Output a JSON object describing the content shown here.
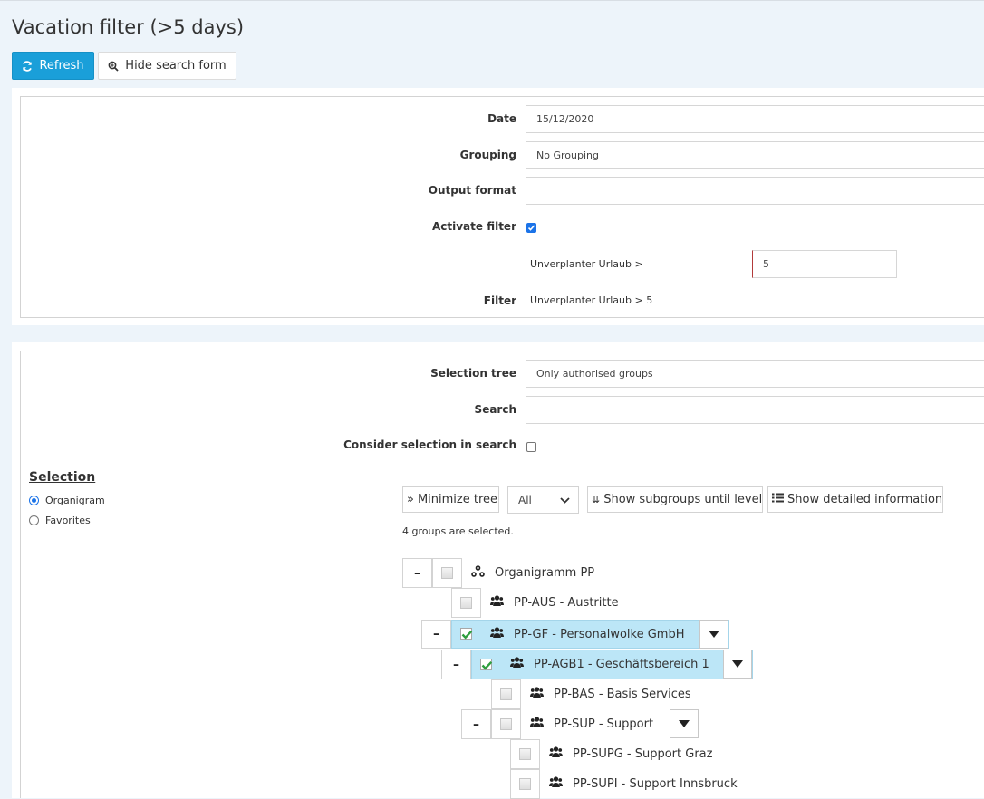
{
  "page": {
    "title": "Vacation filter (>5 days)"
  },
  "toolbar": {
    "refresh_label": "Refresh",
    "hide_label": "Hide search form"
  },
  "form": {
    "date_label": "Date",
    "date_value": "15/12/2020",
    "grouping_label": "Grouping",
    "grouping_value": "No Grouping",
    "output_label": "Output format",
    "output_value": "",
    "activate_label": "Activate filter",
    "activate_checked": true,
    "threshold_label": "Unverplanter Urlaub >",
    "threshold_value": "5",
    "filter_label": "Filter",
    "filter_value": "Unverplanter Urlaub > 5"
  },
  "selection_form": {
    "tree_label": "Selection tree",
    "tree_value": "Only authorised groups",
    "search_label": "Search",
    "search_value": "",
    "consider_label": "Consider selection in search",
    "consider_checked": false
  },
  "selection": {
    "title": "Selection",
    "options": [
      {
        "label": "Organigram",
        "selected": true
      },
      {
        "label": "Favorites",
        "selected": false
      }
    ]
  },
  "tree_toolbar": {
    "minimize_label": "Minimize tree",
    "level_value": "All",
    "subgroups_label": "Show subgroups until level",
    "detailed_label": "Show detailed information"
  },
  "status": {
    "selected_text": "4 groups are selected."
  },
  "tree": {
    "toggle_glyph": "–",
    "nodes": [
      {
        "label": "Organigramm PP",
        "icon": "sitemap-icon",
        "checked": false
      },
      {
        "label": "PP-AUS - Austritte",
        "icon": "users-icon",
        "checked": false
      },
      {
        "label": "PP-GF - Personalwolke GmbH",
        "icon": "users-icon",
        "checked": true
      },
      {
        "label": "PP-AGB1 - Geschäftsbereich 1",
        "icon": "users-icon",
        "checked": true
      },
      {
        "label": "PP-BAS - Basis Services",
        "icon": "users-icon",
        "checked": false
      },
      {
        "label": "PP-SUP - Support",
        "icon": "users-icon",
        "checked": false
      },
      {
        "label": "PP-SUPG - Support Graz",
        "icon": "users-icon",
        "checked": false
      },
      {
        "label": "PP-SUPI - Support Innsbruck",
        "icon": "users-icon",
        "checked": false
      }
    ]
  },
  "colors": {
    "accent": "#1a9fd9",
    "highlight": "#bce6f7",
    "background": "#edf4fa",
    "required_border": "#b23a3a",
    "check_green": "#2e9e3e"
  }
}
